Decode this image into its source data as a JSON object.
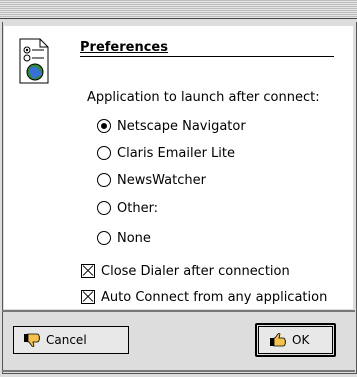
{
  "dialog": {
    "title": "Preferences",
    "prompt": "Application to launch after connect:",
    "launch_options": [
      {
        "label": "Netscape Navigator",
        "selected": true
      },
      {
        "label": "Claris Emailer Lite",
        "selected": false
      },
      {
        "label": "NewsWatcher",
        "selected": false
      },
      {
        "label": "Other:",
        "selected": false
      },
      {
        "label": "None",
        "selected": false
      }
    ],
    "checkboxes": [
      {
        "label": "Close Dialer after connection",
        "checked": true
      },
      {
        "label": "Auto Connect from any application",
        "checked": true
      }
    ]
  },
  "buttons": {
    "cancel_label": "Cancel",
    "ok_label": "OK"
  },
  "icons": {
    "preferences": "preferences-document-icon",
    "cancel": "thumbs-down-icon",
    "ok": "thumbs-up-icon"
  }
}
